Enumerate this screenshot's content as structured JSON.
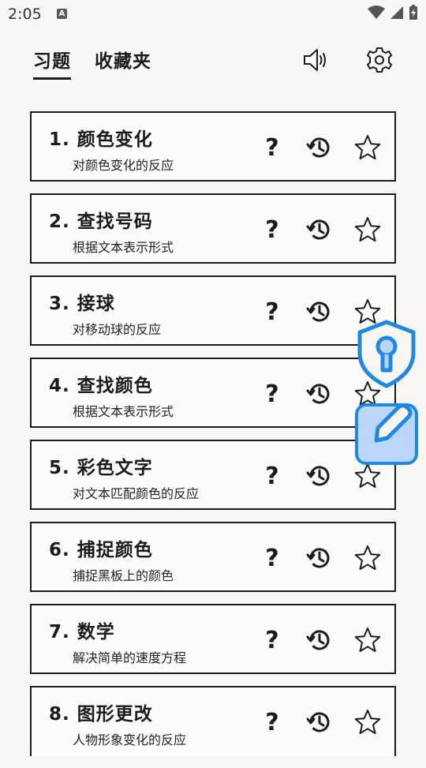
{
  "status": {
    "time": "2:05",
    "notif_badge": "A"
  },
  "tabs": [
    {
      "label": "习题",
      "active": true
    },
    {
      "label": "收藏夹",
      "active": false
    }
  ],
  "header_icons": [
    "speaker-icon",
    "gear-icon"
  ],
  "exercises": [
    {
      "title": "1. 颜色变化",
      "subtitle": "对颜色变化的反应"
    },
    {
      "title": "2. 查找号码",
      "subtitle": "根据文本表示形式"
    },
    {
      "title": "3. 接球",
      "subtitle": "对移动球的反应"
    },
    {
      "title": "4. 查找颜色",
      "subtitle": "根据文本表示形式"
    },
    {
      "title": "5. 彩色文字",
      "subtitle": "对文本匹配颜色的反应"
    },
    {
      "title": "6. 捕捉颜色",
      "subtitle": "捕捉黑板上的颜色"
    },
    {
      "title": "7. 数学",
      "subtitle": "解决简单的速度方程"
    },
    {
      "title": "8. 图形更改",
      "subtitle": "人物形象变化的反应"
    }
  ],
  "help_glyph": "?",
  "colors": {
    "accent_blue": "#1e88e5",
    "light_blue": "#bcd6fb",
    "text": "#1b1b1b",
    "background": "#f7f6f2"
  }
}
